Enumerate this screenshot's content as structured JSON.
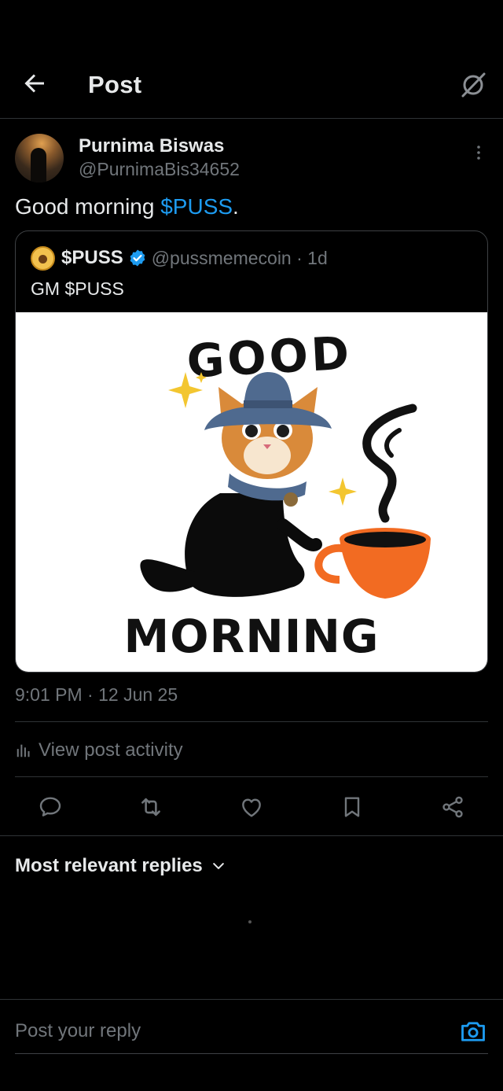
{
  "header": {
    "title": "Post"
  },
  "post": {
    "author_name": "Purnima Biswas",
    "author_handle": "@PurnimaBis34652",
    "text_prefix": "Good morning ",
    "cashtag": "$PUSS",
    "text_suffix": ".",
    "timestamp": "9:01 PM · 12 Jun 25",
    "view_activity_label": "View post activity"
  },
  "quote": {
    "name": "$PUSS",
    "handle_time": "@pussmemecoin · 1d",
    "text": "GM $PUSS",
    "image": {
      "top_word": "GOOD",
      "bottom_word": "MORNING"
    }
  },
  "replies": {
    "sort_label": "Most relevant replies"
  },
  "reply_bar": {
    "placeholder": "Post your reply"
  },
  "colors": {
    "accent": "#1d9bf0",
    "secondary_text": "#71767b",
    "cup": "#f26b22",
    "hat": "#4f6a8f"
  }
}
